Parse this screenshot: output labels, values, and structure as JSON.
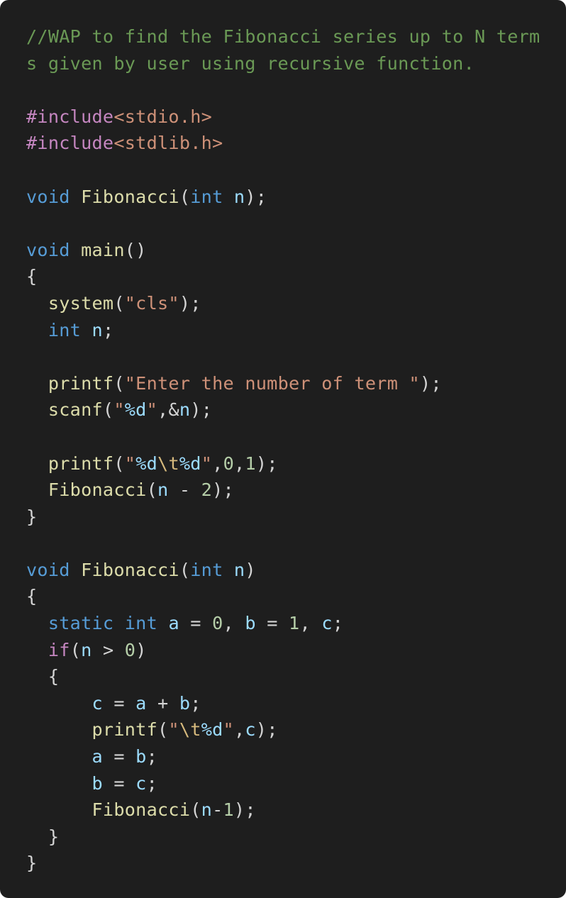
{
  "colors": {
    "background": "#1e1e1e",
    "comment": "#6a9955",
    "directive": "#c586c0",
    "header": "#ce9178",
    "keyword": "#569cd6",
    "function": "#dcdcaa",
    "variable": "#9cdcfe",
    "string": "#ce9178",
    "escape": "#d7ba7d",
    "number": "#b5cea8",
    "punctuation": "#d4d4d4"
  },
  "lines": [
    [
      {
        "t": "//WAP to find the Fibonacci series up to N term",
        "c": "comment"
      }
    ],
    [
      {
        "t": "s given by user using recursive function.",
        "c": "comment"
      }
    ],
    [],
    [
      {
        "t": "#include",
        "c": "directive"
      },
      {
        "t": "<stdio.h>",
        "c": "header"
      }
    ],
    [
      {
        "t": "#include",
        "c": "directive"
      },
      {
        "t": "<stdlib.h>",
        "c": "header"
      }
    ],
    [],
    [
      {
        "t": "void",
        "c": "keyword"
      },
      {
        "t": " ",
        "c": "punct"
      },
      {
        "t": "Fibonacci",
        "c": "func"
      },
      {
        "t": "(",
        "c": "punct"
      },
      {
        "t": "int",
        "c": "keyword"
      },
      {
        "t": " ",
        "c": "punct"
      },
      {
        "t": "n",
        "c": "var"
      },
      {
        "t": ");",
        "c": "punct"
      }
    ],
    [],
    [
      {
        "t": "void",
        "c": "keyword"
      },
      {
        "t": " ",
        "c": "punct"
      },
      {
        "t": "main",
        "c": "func"
      },
      {
        "t": "()",
        "c": "punct"
      }
    ],
    [
      {
        "t": "{",
        "c": "punct"
      }
    ],
    [
      {
        "t": "  ",
        "c": "punct"
      },
      {
        "t": "system",
        "c": "func"
      },
      {
        "t": "(",
        "c": "punct"
      },
      {
        "t": "\"cls\"",
        "c": "string"
      },
      {
        "t": ");",
        "c": "punct"
      }
    ],
    [
      {
        "t": "  ",
        "c": "punct"
      },
      {
        "t": "int",
        "c": "keyword"
      },
      {
        "t": " ",
        "c": "punct"
      },
      {
        "t": "n",
        "c": "var"
      },
      {
        "t": ";",
        "c": "punct"
      }
    ],
    [],
    [
      {
        "t": "  ",
        "c": "punct"
      },
      {
        "t": "printf",
        "c": "func"
      },
      {
        "t": "(",
        "c": "punct"
      },
      {
        "t": "\"Enter the number of term \"",
        "c": "string"
      },
      {
        "t": ");",
        "c": "punct"
      }
    ],
    [
      {
        "t": "  ",
        "c": "punct"
      },
      {
        "t": "scanf",
        "c": "func"
      },
      {
        "t": "(",
        "c": "punct"
      },
      {
        "t": "\"",
        "c": "string"
      },
      {
        "t": "%d",
        "c": "format"
      },
      {
        "t": "\"",
        "c": "string"
      },
      {
        "t": ",&",
        "c": "punct"
      },
      {
        "t": "n",
        "c": "var"
      },
      {
        "t": ");",
        "c": "punct"
      }
    ],
    [],
    [
      {
        "t": "  ",
        "c": "punct"
      },
      {
        "t": "printf",
        "c": "func"
      },
      {
        "t": "(",
        "c": "punct"
      },
      {
        "t": "\"",
        "c": "string"
      },
      {
        "t": "%d",
        "c": "format"
      },
      {
        "t": "\\t",
        "c": "escape"
      },
      {
        "t": "%d",
        "c": "format"
      },
      {
        "t": "\"",
        "c": "string"
      },
      {
        "t": ",",
        "c": "punct"
      },
      {
        "t": "0",
        "c": "number"
      },
      {
        "t": ",",
        "c": "punct"
      },
      {
        "t": "1",
        "c": "number"
      },
      {
        "t": ");",
        "c": "punct"
      }
    ],
    [
      {
        "t": "  ",
        "c": "punct"
      },
      {
        "t": "Fibonacci",
        "c": "func"
      },
      {
        "t": "(",
        "c": "punct"
      },
      {
        "t": "n",
        "c": "var"
      },
      {
        "t": " - ",
        "c": "punct"
      },
      {
        "t": "2",
        "c": "number"
      },
      {
        "t": ");",
        "c": "punct"
      }
    ],
    [
      {
        "t": "}",
        "c": "punct"
      }
    ],
    [],
    [
      {
        "t": "void",
        "c": "keyword"
      },
      {
        "t": " ",
        "c": "punct"
      },
      {
        "t": "Fibonacci",
        "c": "func"
      },
      {
        "t": "(",
        "c": "punct"
      },
      {
        "t": "int",
        "c": "keyword"
      },
      {
        "t": " ",
        "c": "punct"
      },
      {
        "t": "n",
        "c": "var"
      },
      {
        "t": ")",
        "c": "punct"
      }
    ],
    [
      {
        "t": "{",
        "c": "punct"
      }
    ],
    [
      {
        "t": "  ",
        "c": "punct"
      },
      {
        "t": "static",
        "c": "keyword"
      },
      {
        "t": " ",
        "c": "punct"
      },
      {
        "t": "int",
        "c": "keyword"
      },
      {
        "t": " ",
        "c": "punct"
      },
      {
        "t": "a",
        "c": "var"
      },
      {
        "t": " = ",
        "c": "punct"
      },
      {
        "t": "0",
        "c": "number"
      },
      {
        "t": ", ",
        "c": "punct"
      },
      {
        "t": "b",
        "c": "var"
      },
      {
        "t": " = ",
        "c": "punct"
      },
      {
        "t": "1",
        "c": "number"
      },
      {
        "t": ", ",
        "c": "punct"
      },
      {
        "t": "c",
        "c": "var"
      },
      {
        "t": ";",
        "c": "punct"
      }
    ],
    [
      {
        "t": "  ",
        "c": "punct"
      },
      {
        "t": "if",
        "c": "control"
      },
      {
        "t": "(",
        "c": "punct"
      },
      {
        "t": "n",
        "c": "var"
      },
      {
        "t": " > ",
        "c": "punct"
      },
      {
        "t": "0",
        "c": "number"
      },
      {
        "t": ")",
        "c": "punct"
      }
    ],
    [
      {
        "t": "  {",
        "c": "punct"
      }
    ],
    [
      {
        "t": "      ",
        "c": "punct"
      },
      {
        "t": "c",
        "c": "var"
      },
      {
        "t": " = ",
        "c": "punct"
      },
      {
        "t": "a",
        "c": "var"
      },
      {
        "t": " + ",
        "c": "punct"
      },
      {
        "t": "b",
        "c": "var"
      },
      {
        "t": ";",
        "c": "punct"
      }
    ],
    [
      {
        "t": "      ",
        "c": "punct"
      },
      {
        "t": "printf",
        "c": "func"
      },
      {
        "t": "(",
        "c": "punct"
      },
      {
        "t": "\"",
        "c": "string"
      },
      {
        "t": "\\t",
        "c": "escape"
      },
      {
        "t": "%d",
        "c": "format"
      },
      {
        "t": "\"",
        "c": "string"
      },
      {
        "t": ",",
        "c": "punct"
      },
      {
        "t": "c",
        "c": "var"
      },
      {
        "t": ");",
        "c": "punct"
      }
    ],
    [
      {
        "t": "      ",
        "c": "punct"
      },
      {
        "t": "a",
        "c": "var"
      },
      {
        "t": " = ",
        "c": "punct"
      },
      {
        "t": "b",
        "c": "var"
      },
      {
        "t": ";",
        "c": "punct"
      }
    ],
    [
      {
        "t": "      ",
        "c": "punct"
      },
      {
        "t": "b",
        "c": "var"
      },
      {
        "t": " = ",
        "c": "punct"
      },
      {
        "t": "c",
        "c": "var"
      },
      {
        "t": ";",
        "c": "punct"
      }
    ],
    [
      {
        "t": "      ",
        "c": "punct"
      },
      {
        "t": "Fibonacci",
        "c": "func"
      },
      {
        "t": "(",
        "c": "punct"
      },
      {
        "t": "n",
        "c": "var"
      },
      {
        "t": "-",
        "c": "punct"
      },
      {
        "t": "1",
        "c": "number"
      },
      {
        "t": ");",
        "c": "punct"
      }
    ],
    [
      {
        "t": "  }",
        "c": "punct"
      }
    ],
    [
      {
        "t": "}",
        "c": "punct"
      }
    ]
  ]
}
